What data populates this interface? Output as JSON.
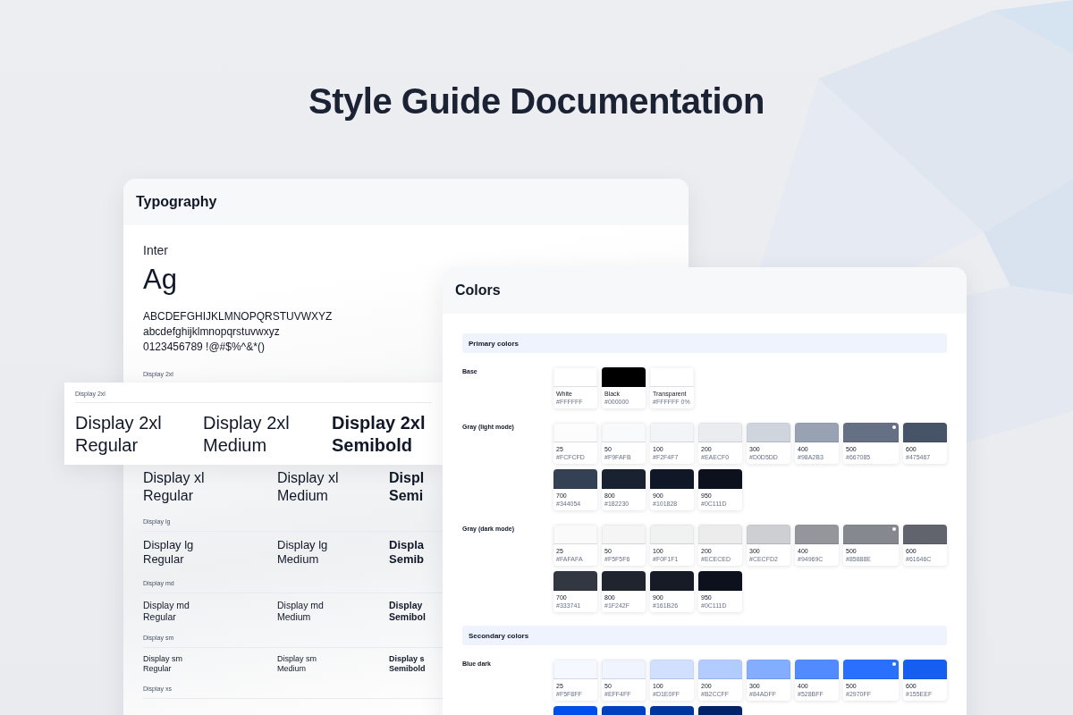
{
  "title": "Style Guide Documentation",
  "typography": {
    "title": "Typography",
    "font_name": "Inter",
    "specimen": "Ag",
    "glyph_lines": [
      "ABCDEFGHIJKLMNOPQRSTUVWXYZ",
      "abcdefghijklmnopqrstuvwxyz",
      "0123456789 !@#$%^&*()"
    ],
    "rows": [
      {
        "label": "Display 2xl"
      },
      {
        "samples": [
          {
            "kind": "regular",
            "lines": [
              "Display xl",
              "Regular"
            ]
          },
          {
            "kind": "medium",
            "lines": [
              "Display xl",
              "Medium"
            ]
          },
          {
            "kind": "semibold",
            "lines": [
              "Displ",
              "Semi"
            ]
          }
        ]
      },
      {
        "label": "Display lg",
        "samples": [
          {
            "kind": "regular",
            "lines": [
              "Display lg",
              "Regular"
            ]
          },
          {
            "kind": "medium",
            "lines": [
              "Display lg",
              "Medium"
            ]
          },
          {
            "kind": "semibold",
            "lines": [
              "Displa",
              "Semib"
            ]
          }
        ]
      },
      {
        "label": "Display md",
        "samples": [
          {
            "kind": "regular",
            "lines": [
              "Display md",
              "Regular"
            ]
          },
          {
            "kind": "medium",
            "lines": [
              "Display md",
              "Medium"
            ]
          },
          {
            "kind": "semibold",
            "lines": [
              "Display",
              "Semibol"
            ]
          }
        ]
      },
      {
        "label": "Display sm",
        "samples": [
          {
            "kind": "regular",
            "lines": [
              "Display sm",
              "Regular"
            ]
          },
          {
            "kind": "medium",
            "lines": [
              "Display sm",
              "Medium"
            ]
          },
          {
            "kind": "semibold",
            "lines": [
              "Display s",
              "Semibold"
            ]
          }
        ]
      },
      {
        "label": "Display xs"
      }
    ]
  },
  "featured_row": {
    "label": "Display 2xl",
    "samples": [
      {
        "kind": "regular",
        "lines": [
          "Display 2xl",
          "Regular"
        ]
      },
      {
        "kind": "medium",
        "lines": [
          "Display 2xl",
          "Medium"
        ]
      },
      {
        "kind": "semibold",
        "lines": [
          "Display 2xl",
          "Semibold"
        ]
      }
    ]
  },
  "colors": {
    "title": "Colors",
    "sections": [
      {
        "heading": "Primary colors",
        "groups": [
          {
            "label": "Base",
            "swatches": [
              {
                "name": "White",
                "hex": "#FFFFFF",
                "color": "#ffffff",
                "primary": false
              },
              {
                "name": "Black",
                "hex": "#000000",
                "color": "#000000",
                "primary": false
              },
              {
                "name": "Transparent",
                "hex": "#FFFFFF 0%",
                "color": "#ffffff",
                "primary": false
              }
            ]
          },
          {
            "label": "Gray (light mode)",
            "swatches": [
              {
                "name": "25",
                "hex": "#FCFCFD",
                "color": "#fcfcfd",
                "primary": false
              },
              {
                "name": "50",
                "hex": "#F9FAFB",
                "color": "#f9fafb",
                "primary": false
              },
              {
                "name": "100",
                "hex": "#F2F4F7",
                "color": "#f2f4f7",
                "primary": false
              },
              {
                "name": "200",
                "hex": "#EAECF0",
                "color": "#eaecf0",
                "primary": false
              },
              {
                "name": "300",
                "hex": "#D0D5DD",
                "color": "#d0d5dd",
                "primary": false
              },
              {
                "name": "400",
                "hex": "#98A2B3",
                "color": "#98a2b3",
                "primary": false
              },
              {
                "name": "500",
                "hex": "#667085",
                "color": "#667085",
                "primary": true
              },
              {
                "name": "600",
                "hex": "#475467",
                "color": "#475467",
                "primary": false
              },
              {
                "name": "700",
                "hex": "#344054",
                "color": "#344054",
                "primary": false
              },
              {
                "name": "800",
                "hex": "#182230",
                "color": "#182230",
                "primary": false
              },
              {
                "name": "900",
                "hex": "#101828",
                "color": "#101828",
                "primary": false
              },
              {
                "name": "950",
                "hex": "#0C111D",
                "color": "#0c111d",
                "primary": false
              }
            ]
          },
          {
            "label": "Gray (dark mode)",
            "swatches": [
              {
                "name": "25",
                "hex": "#FAFAFA",
                "color": "#fafafa",
                "primary": false
              },
              {
                "name": "50",
                "hex": "#F5F5F6",
                "color": "#f5f5f6",
                "primary": false
              },
              {
                "name": "100",
                "hex": "#F0F1F1",
                "color": "#f0f1f1",
                "primary": false
              },
              {
                "name": "200",
                "hex": "#ECECED",
                "color": "#ececed",
                "primary": false
              },
              {
                "name": "300",
                "hex": "#CECFD2",
                "color": "#cecfd2",
                "primary": false
              },
              {
                "name": "400",
                "hex": "#94969C",
                "color": "#94969c",
                "primary": false
              },
              {
                "name": "500",
                "hex": "#85888E",
                "color": "#85888e",
                "primary": true
              },
              {
                "name": "600",
                "hex": "#61646C",
                "color": "#61646c",
                "primary": false
              },
              {
                "name": "700",
                "hex": "#333741",
                "color": "#333741",
                "primary": false
              },
              {
                "name": "800",
                "hex": "#1F242F",
                "color": "#1f242f",
                "primary": false
              },
              {
                "name": "900",
                "hex": "#161B26",
                "color": "#161b26",
                "primary": false
              },
              {
                "name": "950",
                "hex": "#0C111D",
                "color": "#0c111d",
                "primary": false
              }
            ]
          }
        ]
      },
      {
        "heading": "Secondary colors",
        "groups": [
          {
            "label": "Blue dark",
            "swatches": [
              {
                "name": "25",
                "hex": "#F5F8FF",
                "color": "#f5f8ff",
                "primary": false
              },
              {
                "name": "50",
                "hex": "#EFF4FF",
                "color": "#eff4ff",
                "primary": false
              },
              {
                "name": "100",
                "hex": "#D1E0FF",
                "color": "#d1e0ff",
                "primary": false
              },
              {
                "name": "200",
                "hex": "#B2CCFF",
                "color": "#b2ccff",
                "primary": false
              },
              {
                "name": "300",
                "hex": "#84ADFF",
                "color": "#84adff",
                "primary": false
              },
              {
                "name": "400",
                "hex": "#528BFF",
                "color": "#528bff",
                "primary": false
              },
              {
                "name": "500",
                "hex": "#2970FF",
                "color": "#2970ff",
                "primary": true
              },
              {
                "name": "600",
                "hex": "#155EEF",
                "color": "#155eef",
                "primary": false
              },
              {
                "color": "#004eeb"
              },
              {
                "color": "#0040c1"
              },
              {
                "color": "#00359e"
              },
              {
                "color": "#002266"
              }
            ]
          }
        ]
      }
    ]
  }
}
